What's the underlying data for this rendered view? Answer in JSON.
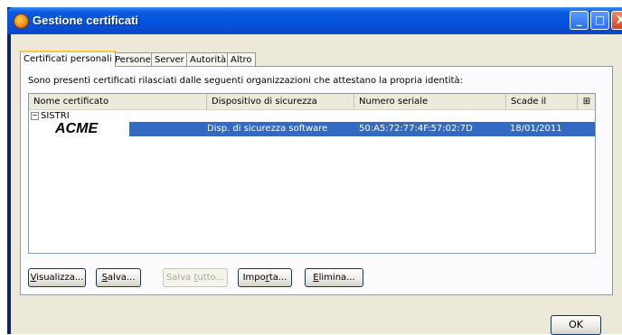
{
  "window": {
    "title": "Gestione certificati"
  },
  "titlebar": {
    "min_label": "_",
    "max_label": "□",
    "close_label": "X"
  },
  "tabs": [
    {
      "label": "Certificati personali"
    },
    {
      "label": "Persone"
    },
    {
      "label": "Server"
    },
    {
      "label": "Autorità"
    },
    {
      "label": "Altro"
    }
  ],
  "panel": {
    "description": "Sono presenti certificati rilasciati dalle seguenti organizzazioni che attestano la propria identità:",
    "columns": [
      "Nome certificato",
      "Dispositivo di sicurezza",
      "Numero seriale",
      "Scade il"
    ],
    "column_picker": "⊞",
    "group": {
      "twisty": "−",
      "name": "SISTRI"
    },
    "cert": {
      "name": "ACME",
      "device": "Disp. di sicurezza software",
      "serial": "50:A5:72:77:4F:57:02:7D",
      "expires": "18/01/2011"
    }
  },
  "buttons": {
    "view": {
      "mnemonic": "V",
      "rest": "isualizza..."
    },
    "save": {
      "mnemonic": "S",
      "rest": "alva..."
    },
    "save_all": {
      "pre": "Salva ",
      "mnemonic": "t",
      "rest": "utto..."
    },
    "import": {
      "pre": "Impo",
      "mnemonic": "r",
      "rest": "ta..."
    },
    "delete": {
      "mnemonic": "E",
      "rest": "limina..."
    }
  },
  "ok_label": "OK",
  "colors": {
    "selection": "#316ac5",
    "titlebar": "#0551dd",
    "tab_highlight": "#ffc83c"
  }
}
